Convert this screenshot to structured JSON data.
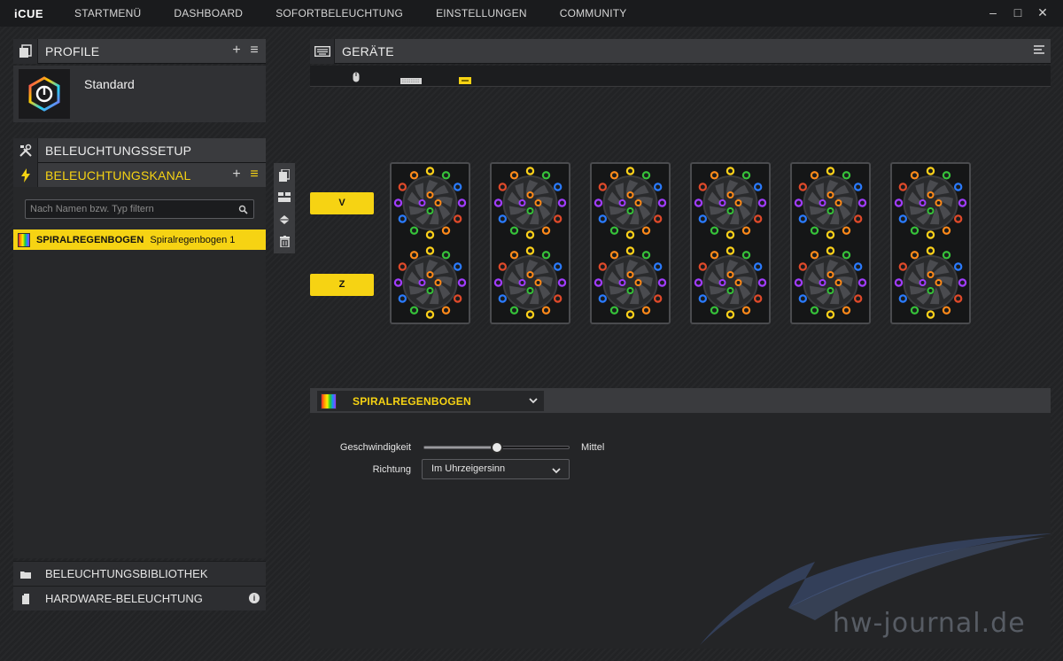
{
  "app": {
    "brand": "iCUE"
  },
  "nav": {
    "items": [
      "STARTMENÜ",
      "DASHBOARD",
      "SOFORTBELEUCHTUNG",
      "EINSTELLUNGEN",
      "COMMUNITY"
    ]
  },
  "window": {
    "minimize": "–",
    "maximize": "□",
    "close": "✕"
  },
  "profile": {
    "title": "PROFILE",
    "add": "+",
    "menu": "≡",
    "name": "Standard"
  },
  "setup": {
    "title": "BELEUCHTUNGSSETUP"
  },
  "channel": {
    "title": "BELEUCHTUNGSKANAL",
    "add": "+",
    "menu": "≡",
    "search_placeholder": "Nach Namen bzw. Typ filtern",
    "layers": [
      {
        "type": "SPIRALREGENBOGEN",
        "name": "Spiralregenbogen 1"
      }
    ]
  },
  "bottom": {
    "library": "BELEUCHTUNGSBIBLIOTHEK",
    "hardware": "HARDWARE-BELEUCHTUNG",
    "info": "i"
  },
  "devices": {
    "title": "GERÄTE",
    "tabs": [
      "mouse-icon",
      "keyboard-icon",
      "controller-icon"
    ],
    "active_tab": 2,
    "mode_buttons": [
      "V",
      "Z"
    ],
    "fan_panels": 6
  },
  "effect": {
    "selected": "SPIRALREGENBOGEN",
    "speed_label": "Geschwindigkeit",
    "speed_value": "Mittel",
    "speed_level": 0.5,
    "direction_label": "Richtung",
    "direction_value": "Im Uhrzeigersinn"
  },
  "watermark": "hw-journal.de",
  "colors": {
    "accent": "#f6d313",
    "led": [
      "#e04a2a",
      "#ff8a1a",
      "#ffd21a",
      "#36c23a",
      "#2a7bff",
      "#a13cff"
    ]
  }
}
